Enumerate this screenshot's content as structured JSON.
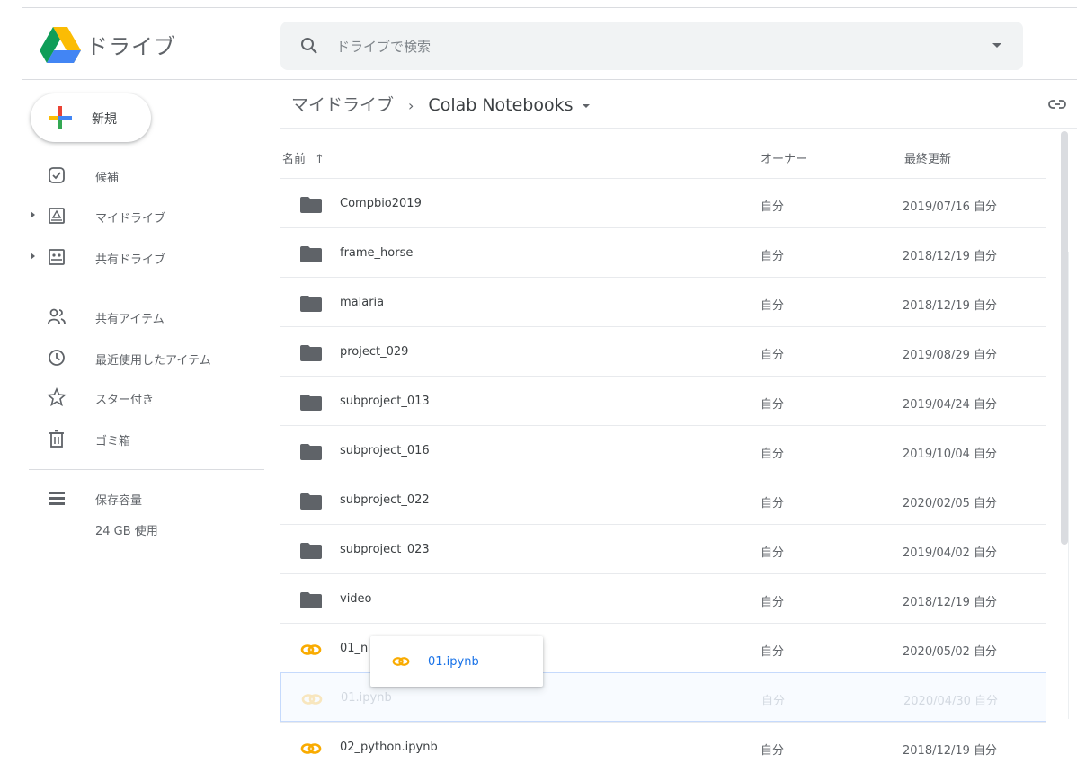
{
  "app": {
    "name": "ドライブ",
    "search_placeholder": "ドライブで検索"
  },
  "sidebar": {
    "new_label": "新規",
    "items": [
      {
        "label": "候補",
        "icon": "suggested-icon"
      },
      {
        "label": "マイドライブ",
        "icon": "my-drive-icon"
      },
      {
        "label": "共有ドライブ",
        "icon": "shared-drives-icon"
      },
      {
        "label": "共有アイテム",
        "icon": "shared-with-me-icon"
      },
      {
        "label": "最近使用したアイテム",
        "icon": "recent-icon"
      },
      {
        "label": "スター付き",
        "icon": "star-icon"
      },
      {
        "label": "ゴミ箱",
        "icon": "trash-icon"
      },
      {
        "label": "保存容量",
        "icon": "storage-icon"
      }
    ],
    "storage_used": "24 GB 使用"
  },
  "breadcrumb": {
    "parent": "マイドライブ",
    "separator": "›",
    "current": "Colab Notebooks"
  },
  "table": {
    "headers": {
      "name": "名前",
      "owner": "オーナー",
      "modified": "最終更新"
    },
    "sort_arrow": "↑",
    "rows": [
      {
        "name": "Compbio2019",
        "owner": "自分",
        "modified": "2019/07/16 自分",
        "type": "folder"
      },
      {
        "name": "frame_horse",
        "owner": "自分",
        "modified": "2018/12/19 自分",
        "type": "folder"
      },
      {
        "name": "malaria",
        "owner": "自分",
        "modified": "2018/12/19 自分",
        "type": "folder"
      },
      {
        "name": "project_029",
        "owner": "自分",
        "modified": "2019/08/29 自分",
        "type": "folder"
      },
      {
        "name": "subproject_013",
        "owner": "自分",
        "modified": "2019/04/24 自分",
        "type": "folder"
      },
      {
        "name": "subproject_016",
        "owner": "自分",
        "modified": "2019/10/04 自分",
        "type": "folder"
      },
      {
        "name": "subproject_022",
        "owner": "自分",
        "modified": "2020/02/05 自分",
        "type": "folder"
      },
      {
        "name": "subproject_023",
        "owner": "自分",
        "modified": "2019/04/02 自分",
        "type": "folder"
      },
      {
        "name": "video",
        "owner": "自分",
        "modified": "2018/12/19 自分",
        "type": "folder"
      },
      {
        "name": "01_n",
        "owner": "自分",
        "modified": "2020/05/02 自分",
        "type": "colab"
      },
      {
        "name": "01.ipynb",
        "owner": "自分",
        "modified": "2020/04/30 自分",
        "type": "colab"
      },
      {
        "name": "02_python.ipynb",
        "owner": "自分",
        "modified": "2018/12/19 自分",
        "type": "colab"
      }
    ]
  },
  "drag_ghost": {
    "name": "01.ipynb"
  },
  "colors": {
    "folder": "#5f6368",
    "colab": "#f9ab00",
    "link_blue": "#1a73e8"
  }
}
